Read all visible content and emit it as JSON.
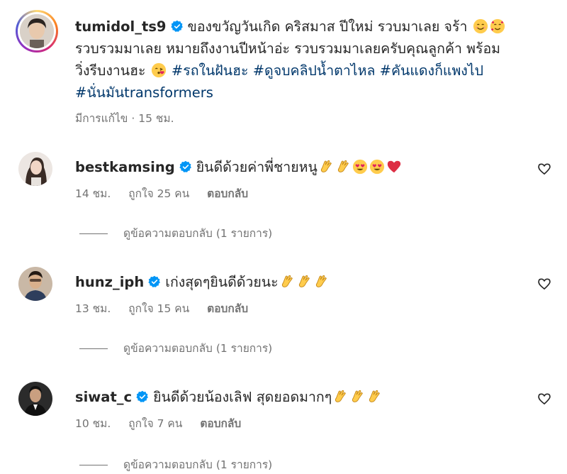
{
  "caption": {
    "username": "tumidol_ts9",
    "text_line1": "ของขวัญวันเกิด คริสมาส ปีใหม่ รวบมาเลย จร้า",
    "text_line2": "รวบรวมมาเลย หมายถึงงานปีหน้าอ่ะ รวบรวมมาเลยครับคุณลูกค้า พร้อม",
    "text_line3_prefix": "วิ่งรีบงานฮะ",
    "hashtags": [
      "#รถในฝันฮะ",
      "#ดูจบคลิปน้ำตาไหล",
      "#คันแดงก็แพงไป",
      "#นั่นมันtransformers"
    ],
    "edited_label": "มีการแก้ไข",
    "time": "15 ชม."
  },
  "comments": [
    {
      "username": "bestkamsing",
      "verified": true,
      "text": "ยินดีด้วยค่าพี่ชายหนู",
      "emojis": [
        "clap-emoji",
        "clap-emoji",
        "heart-eyes-emoji",
        "heart-eyes-emoji",
        "red-heart-emoji"
      ],
      "time": "14 ชม.",
      "likes": "ถูกใจ 25 คน",
      "reply_label": "ตอบกลับ",
      "view_replies": "ดูข้อความตอบกลับ (1 รายการ)"
    },
    {
      "username": "hunz_iph",
      "verified": true,
      "text": "เก่งสุดๆยินดีด้วยนะ",
      "emojis": [
        "clap-emoji",
        "clap-emoji",
        "clap-emoji"
      ],
      "time": "13 ชม.",
      "likes": "ถูกใจ 15 คน",
      "reply_label": "ตอบกลับ",
      "view_replies": "ดูข้อความตอบกลับ (1 รายการ)"
    },
    {
      "username": "siwat_c",
      "verified": true,
      "text": "ยินดีด้วยน้องเลิฟ สุดยอดมากๆ",
      "emojis": [
        "clap-emoji",
        "clap-emoji",
        "clap-emoji"
      ],
      "time": "10 ชม.",
      "likes": "ถูกใจ 7 คน",
      "reply_label": "ตอบกลับ",
      "view_replies": "ดูข้อความตอบกลับ (1 รายการ)"
    }
  ],
  "colors": {
    "text": "#262626",
    "secondary": "#737373",
    "hashtag": "#00376b",
    "verified": "#0095f6",
    "heart_red": "#ed4956"
  },
  "icons": {
    "verified": "verified-badge-icon",
    "like": "heart-outline-icon"
  }
}
